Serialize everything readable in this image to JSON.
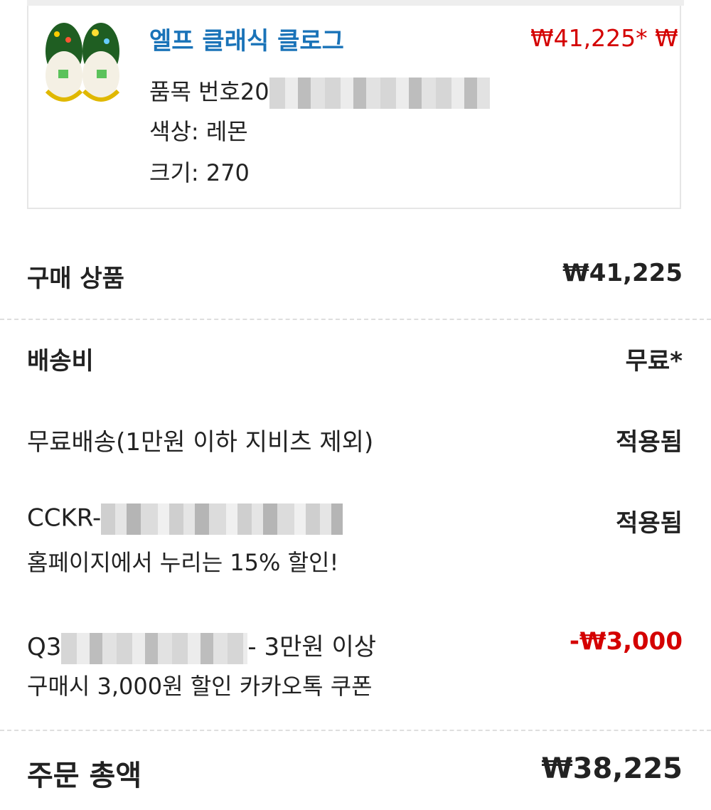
{
  "product": {
    "name": "엘프 클래식 클로그",
    "price": "₩41,225* ₩",
    "item_number_label": "품목 번호20",
    "color_label": "색상: 레몬",
    "size_label": "크기:  270"
  },
  "summary": {
    "subtotal_label": "구매 상품",
    "subtotal_value": "₩41,225",
    "shipping_label": "배송비",
    "shipping_value": "무료*",
    "free_shipping_label": "무료배송(1만원 이하 지비츠 제외)",
    "free_shipping_status": "적용됨",
    "promo1_code": "CCKR-",
    "promo1_desc": "홈페이지에서 누리는 15% 할인!",
    "promo1_status": "적용됨",
    "promo2_code_prefix": "Q3",
    "promo2_code_suffix": "-  3만원 이상",
    "promo2_desc": "구매시 3,000원 할인 카카오톡 쿠폰",
    "promo2_value": "-₩3,000",
    "total_label": "주문 총액",
    "total_value": "₩38,225"
  },
  "colors": {
    "link_blue": "#1a73b8",
    "sale_red": "#d40000"
  }
}
